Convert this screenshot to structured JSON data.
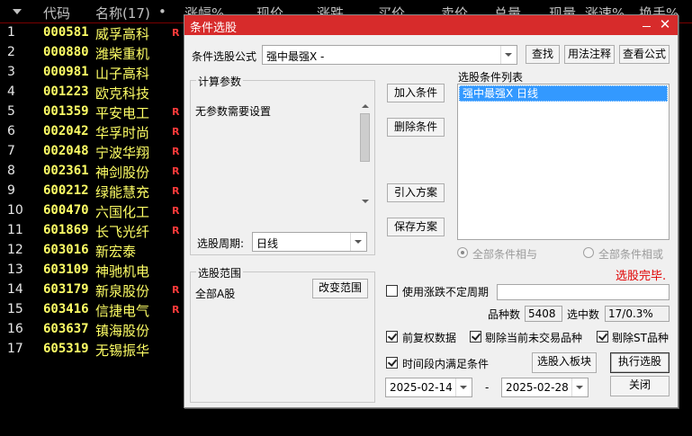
{
  "list": {
    "headers": [
      "代码",
      "名称(17)",
      "•",
      "涨幅%",
      "现价",
      "涨跌",
      "买价",
      "卖价",
      "总量",
      "现量",
      "涨速%",
      "换手%"
    ],
    "rows": [
      {
        "idx": "1",
        "code": "000581",
        "name": "威孚高科",
        "mark": "R"
      },
      {
        "idx": "2",
        "code": "000880",
        "name": "潍柴重机",
        "mark": ""
      },
      {
        "idx": "3",
        "code": "000981",
        "name": "山子高科",
        "mark": ""
      },
      {
        "idx": "4",
        "code": "001223",
        "name": "欧克科技",
        "mark": ""
      },
      {
        "idx": "5",
        "code": "001359",
        "name": "平安电工",
        "mark": "R"
      },
      {
        "idx": "6",
        "code": "002042",
        "name": "华孚时尚",
        "mark": "R"
      },
      {
        "idx": "7",
        "code": "002048",
        "name": "宁波华翔",
        "mark": "R"
      },
      {
        "idx": "8",
        "code": "002361",
        "name": "神剑股份",
        "mark": "R"
      },
      {
        "idx": "9",
        "code": "600212",
        "name": "绿能慧充",
        "mark": "R"
      },
      {
        "idx": "10",
        "code": "600470",
        "name": "六国化工",
        "mark": "R"
      },
      {
        "idx": "11",
        "code": "601869",
        "name": "长飞光纤",
        "mark": "R"
      },
      {
        "idx": "12",
        "code": "603016",
        "name": "新宏泰",
        "mark": ""
      },
      {
        "idx": "13",
        "code": "603109",
        "name": "神驰机电",
        "mark": ""
      },
      {
        "idx": "14",
        "code": "603179",
        "name": "新泉股份",
        "mark": "R"
      },
      {
        "idx": "15",
        "code": "603416",
        "name": "信捷电气",
        "mark": "R"
      },
      {
        "idx": "16",
        "code": "603637",
        "name": "镇海股份",
        "mark": ""
      },
      {
        "idx": "17",
        "code": "605319",
        "name": "无锡振华",
        "mark": ""
      }
    ]
  },
  "dialog": {
    "title": "条件选股",
    "close_glyph": "✕",
    "formula_label": "条件选股公式",
    "formula_value": "强中最强X  -",
    "btn_find": "查找",
    "btn_usage": "用法注释",
    "btn_view": "查看公式",
    "params_group": "计算参数",
    "params_text": "无参数需要设置",
    "period_label": "选股周期:",
    "period_value": "日线",
    "btn_add": "加入条件",
    "btn_delete": "删除条件",
    "btn_import": "引入方案",
    "btn_save": "保存方案",
    "cond_list_label": "选股条件列表",
    "cond_items": [
      "强中最强X  日线"
    ],
    "radio_and": "全部条件相与",
    "radio_or": "全部条件相或",
    "status": "选股完毕.",
    "range_group": "选股范围",
    "range_value": "全部A股",
    "btn_range": "改变范围",
    "chk_uncertain": "使用涨跌不定周期",
    "count_label": "品种数",
    "count_value": "5408",
    "selected_label": "选中数",
    "selected_value": "17/0.3%",
    "chk_fq": "前复权数据",
    "chk_exclude_nontrade": "剔除当前未交易品种",
    "chk_exclude_st": "剔除ST品种",
    "chk_period": "时间段内满足条件",
    "btn_to_block": "选股入板块",
    "btn_execute": "执行选股",
    "date_from": "2025-02-14",
    "date_sep": "-",
    "date_to": "2025-02-28",
    "btn_close": "关闭"
  },
  "colors": {
    "titlebar": "#d72b2b",
    "status_red": "#e00000",
    "code_yellow": "#ffff66",
    "selection_blue": "#3399ff"
  }
}
